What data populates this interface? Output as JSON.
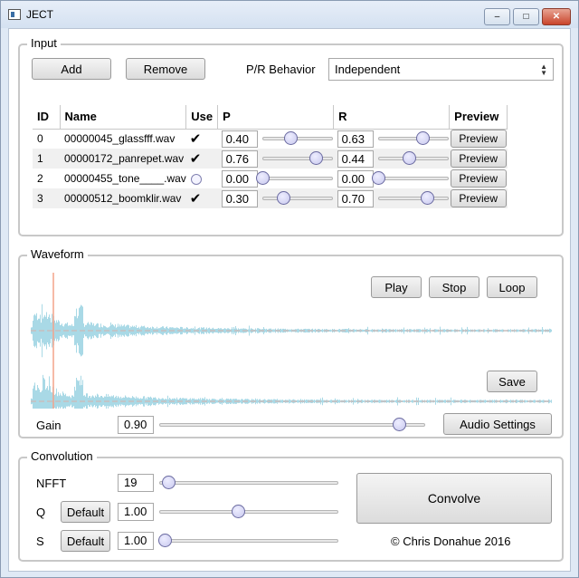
{
  "window": {
    "title": "JECT"
  },
  "input": {
    "group_title": "Input",
    "add_label": "Add",
    "remove_label": "Remove",
    "pr_behavior_label": "P/R Behavior",
    "pr_behavior_value": "Independent",
    "columns": [
      "ID",
      "Name",
      "Use",
      "P",
      "R",
      "Preview"
    ],
    "rows": [
      {
        "id": "0",
        "name": "00000045_glassfff.wav",
        "use": true,
        "p": "0.40",
        "p_level": 0.4,
        "r": "0.63",
        "r_level": 0.63,
        "preview": "Preview"
      },
      {
        "id": "1",
        "name": "00000172_panrepet.wav",
        "use": true,
        "p": "0.76",
        "p_level": 0.76,
        "r": "0.44",
        "r_level": 0.44,
        "preview": "Preview"
      },
      {
        "id": "2",
        "name": "00000455_tone____.wav",
        "use": false,
        "p": "0.00",
        "p_level": 0.0,
        "r": "0.00",
        "r_level": 0.0,
        "preview": "Preview"
      },
      {
        "id": "3",
        "name": "00000512_boomklir.wav",
        "use": true,
        "p": "0.30",
        "p_level": 0.3,
        "r": "0.70",
        "r_level": 0.7,
        "preview": "Preview"
      }
    ]
  },
  "waveform": {
    "group_title": "Waveform",
    "play_label": "Play",
    "stop_label": "Stop",
    "loop_label": "Loop",
    "save_label": "Save",
    "gain_label": "Gain",
    "gain_value": "0.90",
    "gain_level": 0.9,
    "audio_settings_label": "Audio Settings",
    "wave_color": "#a9d9e6",
    "marker_color": "#f4a38a"
  },
  "convolution": {
    "group_title": "Convolution",
    "nfft_label": "NFFT",
    "nfft_value": "19",
    "nfft_level": 0.05,
    "q_label": "Q",
    "q_default_label": "Default",
    "q_value": "1.00",
    "q_level": 0.44,
    "s_label": "S",
    "s_default_label": "Default",
    "s_value": "1.00",
    "s_level": 0.03,
    "convolve_label": "Convolve",
    "copyright": "© Chris Donahue 2016"
  }
}
